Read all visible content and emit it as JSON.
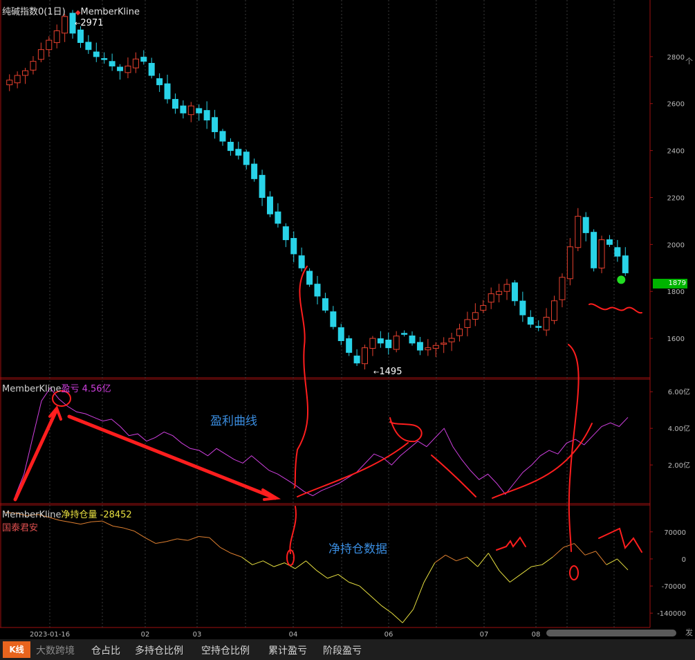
{
  "chart_data": {
    "type": "candlestick",
    "months_axis": [
      "2023-01-16",
      "02",
      "03",
      "04",
      "06",
      "07",
      "08"
    ],
    "ohlc_close_path_approx": [
      2700,
      2720,
      2740,
      2780,
      2830,
      2870,
      2910,
      2971,
      2900,
      2860,
      2830,
      2800,
      2790,
      2760,
      2740,
      2760,
      2790,
      2780,
      2720,
      2680,
      2620,
      2580,
      2560,
      2590,
      2560,
      2530,
      2480,
      2440,
      2400,
      2380,
      2340,
      2280,
      2200,
      2130,
      2090,
      2020,
      1960,
      1900,
      1830,
      1780,
      1720,
      1650,
      1590,
      1540,
      1495,
      1560,
      1600,
      1580,
      1560,
      1610,
      1620,
      1580,
      1550,
      1560,
      1570,
      1580,
      1600,
      1640,
      1680,
      1710,
      1740,
      1790,
      1800,
      1830,
      1760,
      1700,
      1660,
      1650,
      1690,
      1760,
      1860,
      1990,
      2120,
      2050,
      1900,
      2020,
      2000,
      1950,
      1879
    ],
    "price_axis": {
      "ticks": [
        2800,
        2600,
        2400,
        2200,
        2000,
        1800,
        1600
      ],
      "range": [
        1495,
        2971
      ]
    },
    "price_high_label": "2971",
    "price_low_label": "1495",
    "last_price": "1879",
    "profit_series_approx": [
      0.3,
      1.5,
      3.5,
      5.5,
      6.2,
      5.6,
      5.2,
      4.9,
      4.8,
      4.6,
      4.4,
      4.5,
      4.1,
      3.6,
      3.7,
      3.3,
      3.5,
      3.8,
      3.6,
      3.2,
      2.9,
      2.8,
      2.5,
      2.9,
      2.6,
      2.3,
      2.1,
      2.5,
      2.1,
      1.7,
      1.5,
      1.2,
      0.9,
      0.55,
      0.32,
      0.6,
      0.8,
      1.0,
      1.3,
      1.6,
      2.1,
      2.6,
      2.4,
      2.0,
      2.5,
      2.9,
      3.3,
      3.0,
      3.5,
      4.0,
      3.0,
      2.3,
      1.7,
      1.2,
      1.5,
      1.0,
      0.4,
      1.0,
      1.6,
      2.0,
      2.5,
      2.8,
      2.6,
      3.2,
      3.4,
      3.1,
      3.6,
      4.1,
      4.3,
      4.1,
      4.6
    ],
    "profit_axis": {
      "ticks": [
        "6.00亿",
        "4.00亿",
        "2.00亿"
      ],
      "range": [
        0,
        6.5
      ]
    },
    "netpos_series_approx": [
      120000,
      118000,
      112000,
      115000,
      108000,
      100000,
      95000,
      90000,
      96000,
      98000,
      85000,
      80000,
      72000,
      55000,
      40000,
      45000,
      52000,
      48000,
      58000,
      55000,
      30000,
      15000,
      5000,
      -15000,
      -5000,
      -20000,
      -10000,
      -25000,
      -5000,
      -30000,
      -50000,
      -40000,
      -60000,
      -70000,
      -95000,
      -120000,
      -140000,
      -165000,
      -130000,
      -60000,
      -10000,
      10000,
      -5000,
      5000,
      -20000,
      15000,
      -30000,
      -60000,
      -40000,
      -20000,
      -15000,
      5000,
      30000,
      40000,
      10000,
      20000,
      -15000,
      0,
      -28452
    ],
    "netpos_axis": {
      "ticks": [
        "70000",
        "0",
        "-70000",
        "-140000"
      ],
      "range": [
        -170000,
        125000
      ]
    },
    "colors": {
      "up": "#e8412f",
      "down": "#29d3e8",
      "profit_line": "#d040e0",
      "netpos_pos": "#e08030",
      "netpos_neg": "#e8e040",
      "panel_border": "#a01010",
      "annotation": "#ff1e1e",
      "cn_label": "#3a8de0"
    }
  },
  "panel1": {
    "title": "纯碱指数0(1日)",
    "indicator": "MemberKline",
    "indicator_marker": "◆",
    "smiley_icon": "smiley-icon"
  },
  "panel2": {
    "title": "MemberKline",
    "metric_label": "盈亏",
    "metric_value": "4.56亿",
    "annotation": "盈利曲线"
  },
  "panel3": {
    "title": "MemberKline",
    "metric_label": "净持仓量",
    "metric_value": "-28452",
    "member": "国泰君安",
    "annotation": "净持仓数据"
  },
  "tabs": [
    {
      "label": "仓占比"
    },
    {
      "label": "多持仓比例"
    },
    {
      "label": "空持仓比例"
    },
    {
      "label": "累计盈亏"
    },
    {
      "label": "阶段盈亏"
    }
  ],
  "logo_text": "K线",
  "watermark": "大数跨境",
  "right_edge": {
    "top_char": "个",
    "bottom_char": "发"
  }
}
